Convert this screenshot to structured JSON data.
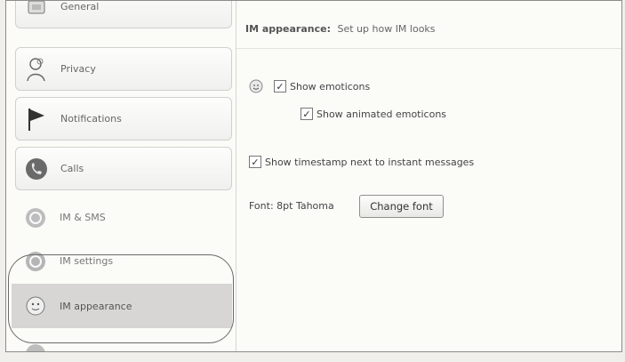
{
  "sidebar": {
    "items": [
      {
        "label": "General",
        "icon": "general-icon"
      },
      {
        "label": "Privacy",
        "icon": "privacy-icon"
      },
      {
        "label": "Notifications",
        "icon": "flag-icon"
      },
      {
        "label": "Calls",
        "icon": "phone-icon"
      },
      {
        "label": "IM & SMS",
        "icon": "chat-icon"
      },
      {
        "label": "IM settings",
        "icon": "chat-icon"
      },
      {
        "label": "IM appearance",
        "icon": "smiley-icon"
      }
    ]
  },
  "header": {
    "title": "IM appearance:",
    "subtitle": "Set up how IM looks"
  },
  "options": {
    "show_emoticons": "Show emoticons",
    "show_animated": "Show animated emoticons",
    "show_timestamp": "Show timestamp next to instant messages"
  },
  "font": {
    "label": "Font: 8pt Tahoma",
    "button": "Change font"
  }
}
